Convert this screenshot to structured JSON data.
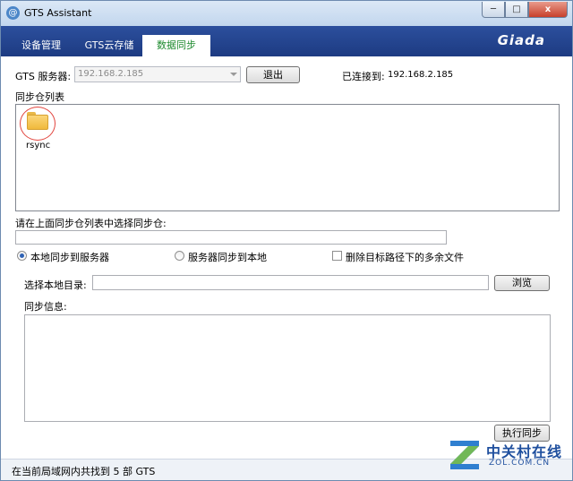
{
  "window": {
    "title": "GTS Assistant",
    "minimize": "─",
    "maximize": "□",
    "close": "x",
    "app_icon": "@"
  },
  "tabs": [
    {
      "label": "设备管理",
      "active": false
    },
    {
      "label": "GTS云存储",
      "active": false
    },
    {
      "label": "数据同步",
      "active": true
    }
  ],
  "brand": "Giada",
  "server": {
    "label": "GTS 服务器:",
    "value": "192.168.2.185",
    "logout_label": "退出",
    "connected_label": "已连接到:",
    "connected_value": "192.168.2.185"
  },
  "sync_list": {
    "label": "同步仓列表",
    "items": [
      {
        "name": "rsync",
        "icon": "folder-icon"
      }
    ]
  },
  "select_prompt": {
    "label": "请在上面同步仓列表中选择同步仓:",
    "value": ""
  },
  "direction": {
    "local_to_server": "本地同步到服务器",
    "server_to_local": "服务器同步到本地",
    "selected": "local_to_server",
    "delete_extra": "删除目标路径下的多余文件",
    "delete_extra_checked": false
  },
  "local_dir": {
    "label": "选择本地目录:",
    "value": "",
    "browse_label": "浏览"
  },
  "sync_info": {
    "label": "同步信息:",
    "value": ""
  },
  "execute_label": "执行同步",
  "status": "在当前局域网内共找到 5 部 GTS",
  "watermark": {
    "main": "中关村在线",
    "sub": "ZOL.COM.CN"
  },
  "colors": {
    "tab_band": "#1d3b82",
    "active_tab_text": "#1d8a2e",
    "annotation_circle": "#e2453f"
  }
}
